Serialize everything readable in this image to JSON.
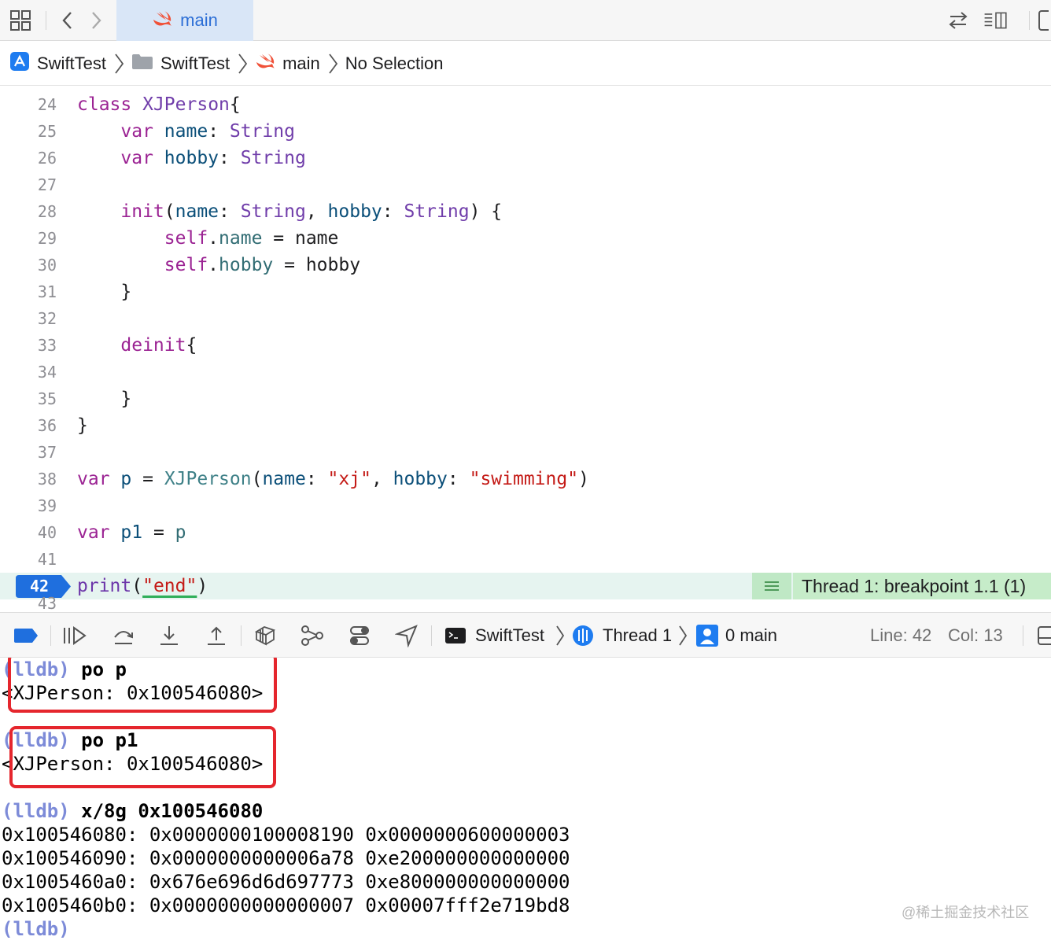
{
  "tabbar": {
    "active_tab": "main"
  },
  "jumpbar": {
    "crumbs": [
      "SwiftTest",
      "SwiftTest",
      "main",
      "No Selection"
    ]
  },
  "editor": {
    "lines": [
      {
        "num": "24"
      },
      {
        "num": "25"
      },
      {
        "num": "26"
      },
      {
        "num": "27"
      },
      {
        "num": "28"
      },
      {
        "num": "29"
      },
      {
        "num": "30"
      },
      {
        "num": "31"
      },
      {
        "num": "32"
      },
      {
        "num": "33"
      },
      {
        "num": "34"
      },
      {
        "num": "35"
      },
      {
        "num": "36"
      },
      {
        "num": "37"
      },
      {
        "num": "38"
      },
      {
        "num": "39"
      },
      {
        "num": "40"
      },
      {
        "num": "41"
      },
      {
        "num": "42"
      }
    ],
    "tokens": {
      "class_kw": "class",
      "class_name": "XJPerson",
      "var_kw": "var",
      "name_prop": "name",
      "hobby_prop": "hobby",
      "string_type": "String",
      "init_kw": "init",
      "self_kw": "self",
      "deinit_kw": "deinit",
      "p_var": "p",
      "p1_var": "p1",
      "xj_str": "\"xj\"",
      "swimming_str": "\"swimming\"",
      "print_fn": "print",
      "end_str": "\"end\""
    },
    "current_line": "42",
    "breakpoint_label": "Thread 1: breakpoint 1.1 (1)"
  },
  "debugbar": {
    "target": "SwiftTest",
    "thread": "Thread 1",
    "frame": "0 main",
    "line_label": "Line: 42",
    "col_label": "Col: 13"
  },
  "console": {
    "prompt": "(lldb)",
    "cmd1": "po p",
    "out1": "<XJPerson: 0x100546080>",
    "cmd2": "po p1",
    "out2": "<XJPerson: 0x100546080>",
    "cmd3": "x/8g 0x100546080",
    "memory": [
      "0x100546080: 0x0000000100008190 0x0000000600000003",
      "0x100546090: 0x0000000000006a78 0xe200000000000000",
      "0x1005460a0: 0x676e696d6d697773 0xe800000000000000",
      "0x1005460b0: 0x0000000000000007 0x00007fff2e719bd8"
    ]
  },
  "watermark": "@稀土掘金技术社区",
  "colors": {
    "accent": "#2d6fd6",
    "keyword": "#9b2393",
    "string": "#c41a16",
    "breakpoint": "#1f6fde",
    "highlight_box": "#e5262d"
  }
}
